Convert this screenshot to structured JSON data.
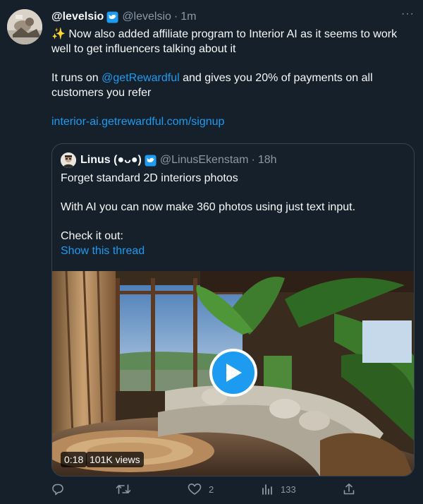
{
  "tweet": {
    "author_name": "@levelsio",
    "author_handle": "@levelsio",
    "dot": "·",
    "time": "1m",
    "more": "···",
    "line1_emoji": "✨",
    "line1_text": " Now also added affiliate program to Interior AI as it seems to work well to get influencers talking about it",
    "line2_pre": "It runs on ",
    "line2_mention": "@getRewardful",
    "line2_post": " and gives you 20% of payments on all customers you refer",
    "url": "interior-ai.getrewardful.com/signup"
  },
  "quote": {
    "author_name": "Linus (●ᴗ●)",
    "author_handle": "@LinusEkenstam",
    "dot": "·",
    "time": "18h",
    "line1": "Forget standard 2D interiors photos",
    "line2": "With AI you can now make 360 photos using just text input.",
    "line3": "Check it out:",
    "show_thread": "Show this thread",
    "video": {
      "duration": "0:18",
      "views": "101K views"
    }
  },
  "actions": {
    "replies": "",
    "retweets": "",
    "likes": "2",
    "views": "133"
  },
  "colors": {
    "background": "#15202b",
    "accent": "#1d9bf0",
    "muted": "#8b98a5",
    "border": "#38444d"
  },
  "icons": [
    "verified-badge-icon",
    "more-icon",
    "play-icon",
    "reply-icon",
    "retweet-icon",
    "like-icon",
    "views-icon",
    "share-icon"
  ]
}
